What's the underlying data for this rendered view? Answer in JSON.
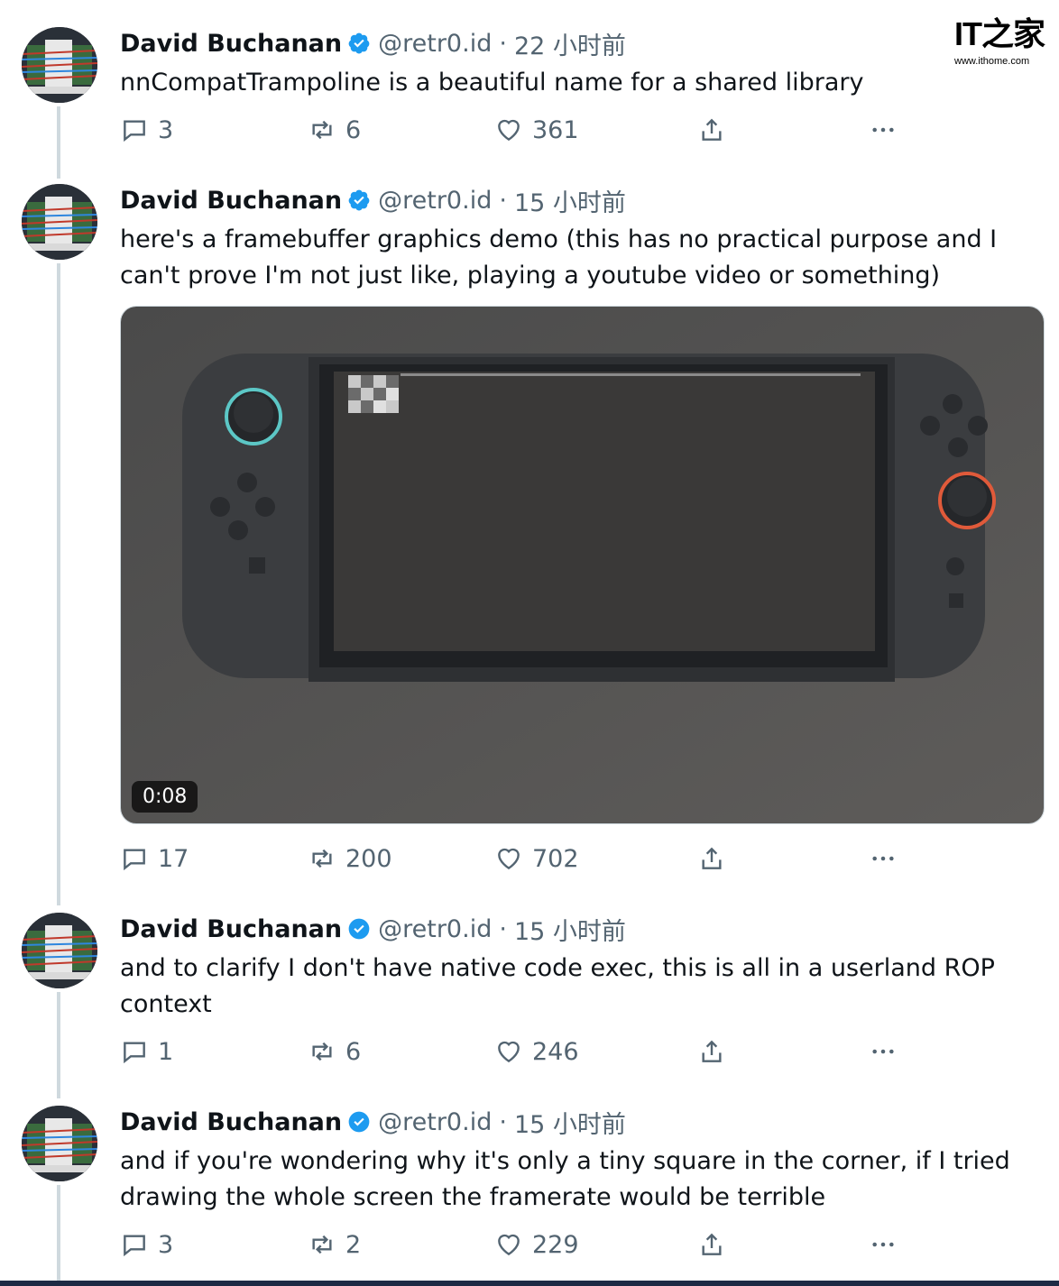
{
  "watermark": {
    "logo_text": "IT之家",
    "url": "www.ithome.com"
  },
  "tweets": [
    {
      "name": "David Buchanan",
      "handle": "@retr0.id",
      "time": "22 小时前",
      "text": "nnCompatTrampoline is a beautiful name for a shared library",
      "replies": "3",
      "retweets": "6",
      "likes": "361"
    },
    {
      "name": "David Buchanan",
      "handle": "@retr0.id",
      "time": "15 小时前",
      "text": "here's a framebuffer graphics demo (this has no practical purpose and I can't prove I'm not just like, playing a youtube video or something)",
      "media_duration": "0:08",
      "replies": "17",
      "retweets": "200",
      "likes": "702"
    },
    {
      "name": "David Buchanan",
      "handle": "@retr0.id",
      "time": "15 小时前",
      "text": "and to clarify I don't have native code exec, this is all in a userland ROP context",
      "replies": "1",
      "retweets": "6",
      "likes": "246"
    },
    {
      "name": "David Buchanan",
      "handle": "@retr0.id",
      "time": "15 小时前",
      "text": "and if you're wondering why it's only a tiny square in the corner, if I tried drawing the whole screen the framerate would be terrible",
      "replies": "3",
      "retweets": "2",
      "likes": "229"
    }
  ],
  "colors": {
    "verified": "#1d9bf0",
    "muted": "#536471",
    "text": "#0f1419",
    "thread_line": "#cfd9de"
  }
}
